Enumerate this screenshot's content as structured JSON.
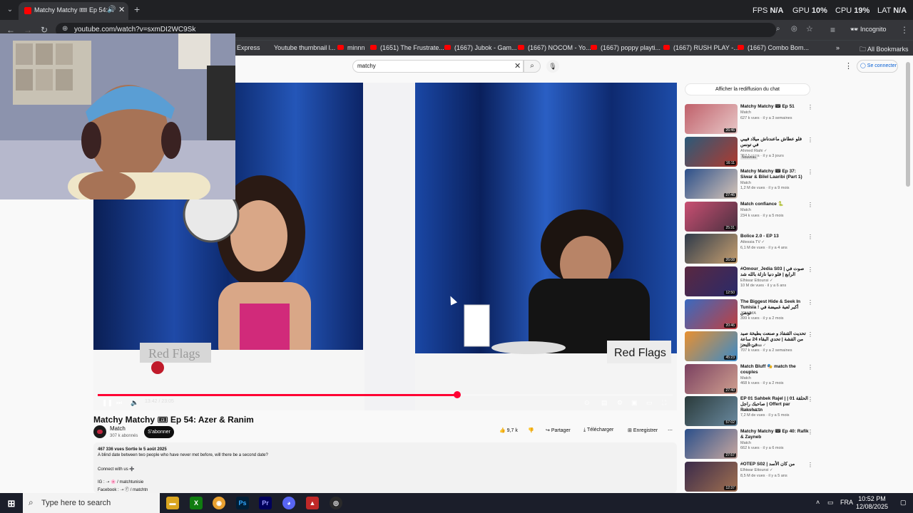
{
  "browser": {
    "tab_title": "Matchy Matchy 🎟 Ep 54: A",
    "url": "youtube.com/watch?v=sxmDI2WC9Sk",
    "incognito_label": "Incognito",
    "all_bookmarks_label": "All Bookmarks",
    "bookmarks": [
      "Express",
      "Youtube thumbnail l...",
      "minnn",
      "(1651) The Frustrate...",
      "(1667) Jubok - Gam...",
      "(1667) NOCOM - Yo...",
      "(1667) poppy playti...",
      "(1667) RUSH PLAY -...",
      "(1667) Combo Bom..."
    ]
  },
  "hud": {
    "fps_label": "FPS",
    "fps_value": "N/A",
    "gpu_label": "GPU",
    "gpu_value": "10%",
    "cpu_label": "CPU",
    "cpu_value": "19%",
    "lat_label": "LAT",
    "lat_value": "N/A"
  },
  "youtube": {
    "search_value": "matchy",
    "signin_label": "Se connecter",
    "chat_replay_label": "Afficher la rediffusion du chat"
  },
  "player": {
    "time": "13:42 / 23:05",
    "progress": 0.625,
    "sign_left": "Red Flags",
    "sign_right": "Red Flags"
  },
  "video": {
    "title": "Matchy Matchy 🎟 Ep 54: Azer & Ranim",
    "channel": "Match",
    "subscribers": "307 k abonnés",
    "subscribe_label": "S'abonner",
    "likes": "9,7 k",
    "share_label": "Partager",
    "download_label": "Télécharger",
    "save_label": "Enregistrer",
    "description": {
      "meta": "467 336 vues  Sortie le 5 août 2025",
      "text": "A blind date between two people who have never met before, will there be a second date?",
      "connect": "Connect with us ➕",
      "ig": "IG : ➝ 🌸 / matchtunisie",
      "facebook": "Facebook : ➝ ⓕ / matchtn"
    }
  },
  "recommendations": [
    {
      "title": "Matchy Matchy 🎟 Ep 51",
      "channel": "Match",
      "meta": "627 k vues · il y a 3 semaines",
      "duration": "26:46",
      "colors": [
        "#c0606a",
        "#e8c8c8"
      ]
    },
    {
      "title": "فلو عطاش ماعندناش ميلاد فيبي في تونس",
      "channel": "Ahmed Riahi ✓",
      "meta": "264 k vues · il y a 3 jours",
      "duration": "16:11",
      "badge": "Nouveau",
      "colors": [
        "#2a5a7a",
        "#b03a2e"
      ]
    },
    {
      "title": "Matchy Matchy 🎟 Ep 37: Siwar & Bilel Laaribi (Part 1)",
      "channel": "Match",
      "meta": "1,2 M de vues · il y a 9 mois",
      "duration": "27:46",
      "colors": [
        "#2b4f8a",
        "#d8c6b8"
      ]
    },
    {
      "title": "Match confiance 🐍",
      "channel": "Match",
      "meta": "234 k vues · il y a 5 mois",
      "duration": "25:31",
      "colors": [
        "#c94f72",
        "#4a3040"
      ]
    },
    {
      "title": "Bolice 2.0 - EP 13",
      "channel": "Attessia TV ✓",
      "meta": "6,1 M de vues · il y a 4 ans",
      "duration": "26:08",
      "colors": [
        "#2e3a4a",
        "#c8a070"
      ]
    },
    {
      "title": "#Omour_Jedia S03 | صوت في الرابع | فلو دنيا نازلة بالله شد",
      "channel": "Elhiwar Ettounsi ✓",
      "meta": "10 M de vues · il y a 6 ans",
      "duration": "12:50",
      "colors": [
        "#5a2840",
        "#2a2a6a"
      ]
    },
    {
      "title": "The Biggest Hide & Seek In Tunisia ! أكبر لعبة غميضة في تونس",
      "channel": "JOUJMA",
      "meta": "399 k vues · il y a 2 mois",
      "duration": "20:46",
      "colors": [
        "#3a6ac0",
        "#c04040"
      ]
    },
    {
      "title": "تحديت القنفاذ و صنعت بطيخة صيد من القشة | تحدي البقاء 24 ساعة في البحر...",
      "channel": "Nesyen Sea ✓",
      "meta": "707 k vues · il y a 2 semaines",
      "duration": "45:23",
      "colors": [
        "#e89030",
        "#3a8ac8"
      ]
    },
    {
      "title": "Match Bluff 🎭 match the couples",
      "channel": "Match",
      "meta": "468 k vues · il y a 2 mois",
      "duration": "27:40",
      "colors": [
        "#7a4060",
        "#d0a090"
      ]
    },
    {
      "title": "EP 01 Sahbek Rajel | الحلقة 01 | صاحبك راجل | Offert par Raksha.tn",
      "channel": "Nessma TV",
      "meta": "7,2 M de vues · il y a 5 mois",
      "duration": "57:02",
      "colors": [
        "#2a3a3a",
        "#6a8aa0"
      ]
    },
    {
      "title": "Matchy Matchy 🎟 Ep 40: Rafik & Zayneb",
      "channel": "Match",
      "meta": "662 k vues · il y a 6 mois",
      "duration": "27:57",
      "colors": [
        "#2b4f8a",
        "#c8a8a0"
      ]
    },
    {
      "title": "#OTEP S02 | من كان الأسد",
      "channel": "Elhiwar Ettounsi ✓",
      "meta": "8,5 M de vues · il y a 5 ans",
      "duration": "12:37",
      "colors": [
        "#3a2a4a",
        "#a07050"
      ]
    }
  ],
  "taskbar": {
    "search_placeholder": "Type here to search",
    "language": "FRA",
    "time": "10:52 PM",
    "date": "12/08/2025"
  }
}
